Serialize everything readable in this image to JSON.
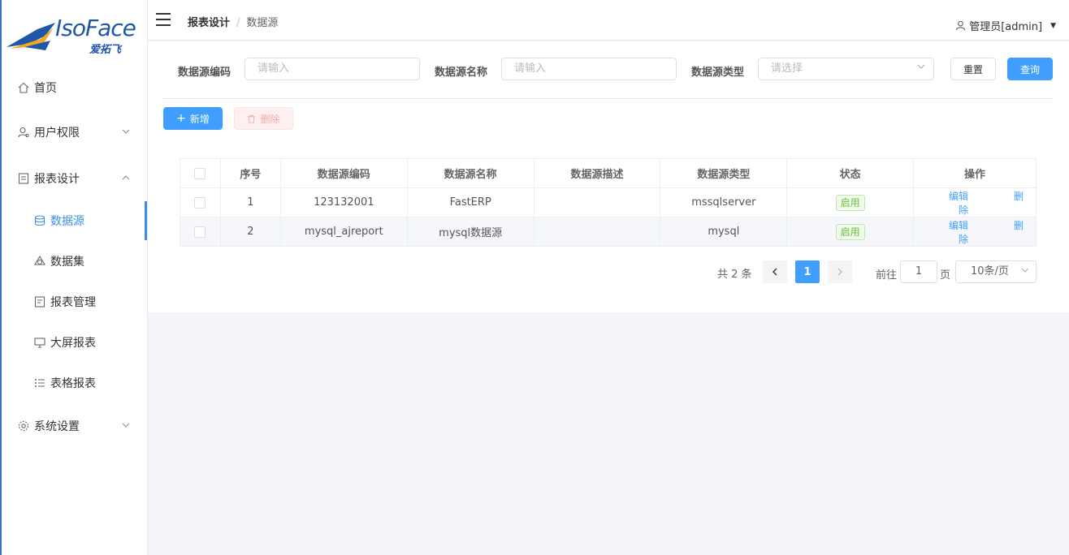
{
  "logo": {
    "text": "IsoFace",
    "sub_text": "爱拓飞"
  },
  "colors": {
    "accent": "#409eff",
    "brand": "#3a6fc4",
    "success": "#67c23a",
    "danger": "#f56c6c"
  },
  "sidebar": {
    "items": [
      {
        "label": "首页",
        "icon": "home-icon"
      },
      {
        "label": "用户权限",
        "icon": "user-icon"
      },
      {
        "label": "报表设计",
        "icon": "report-design-icon"
      },
      {
        "label": "数据源",
        "icon": "database-icon"
      },
      {
        "label": "数据集",
        "icon": "dataset-icon"
      },
      {
        "label": "报表管理",
        "icon": "report-manage-icon"
      },
      {
        "label": "大屏报表",
        "icon": "monitor-icon"
      },
      {
        "label": "表格报表",
        "icon": "list-icon"
      },
      {
        "label": "系统设置",
        "icon": "gear-icon"
      }
    ]
  },
  "header": {
    "breadcrumb_parent": "报表设计",
    "breadcrumb_sep": "/",
    "breadcrumb_current": "数据源",
    "user": "管理员[admin]"
  },
  "filters": {
    "code_label": "数据源编码",
    "code_placeholder": "请输入",
    "name_label": "数据源名称",
    "name_placeholder": "请输入",
    "type_label": "数据源类型",
    "type_placeholder": "请选择",
    "reset": "重置",
    "search": "查询"
  },
  "actions": {
    "add": "新增",
    "delete": "删除"
  },
  "table": {
    "columns": [
      "序号",
      "数据源编码",
      "数据源名称",
      "数据源描述",
      "数据源类型",
      "状态",
      "操作"
    ],
    "rows": [
      {
        "index": "1",
        "code": "123132001",
        "name": "FastERP",
        "desc": "",
        "type": "mssqlserver",
        "status": "启用",
        "edit": "编辑",
        "delete": "删除"
      },
      {
        "index": "2",
        "code": "mysql_ajreport",
        "name": "mysql数据源",
        "desc": "",
        "type": "mysql",
        "status": "启用",
        "edit": "编辑",
        "delete": "删除"
      }
    ]
  },
  "pagination": {
    "total": "共 2 条",
    "current": "1",
    "goto_prefix": "前往",
    "goto_value": "1",
    "goto_suffix": "页",
    "page_size": "10条/页"
  }
}
